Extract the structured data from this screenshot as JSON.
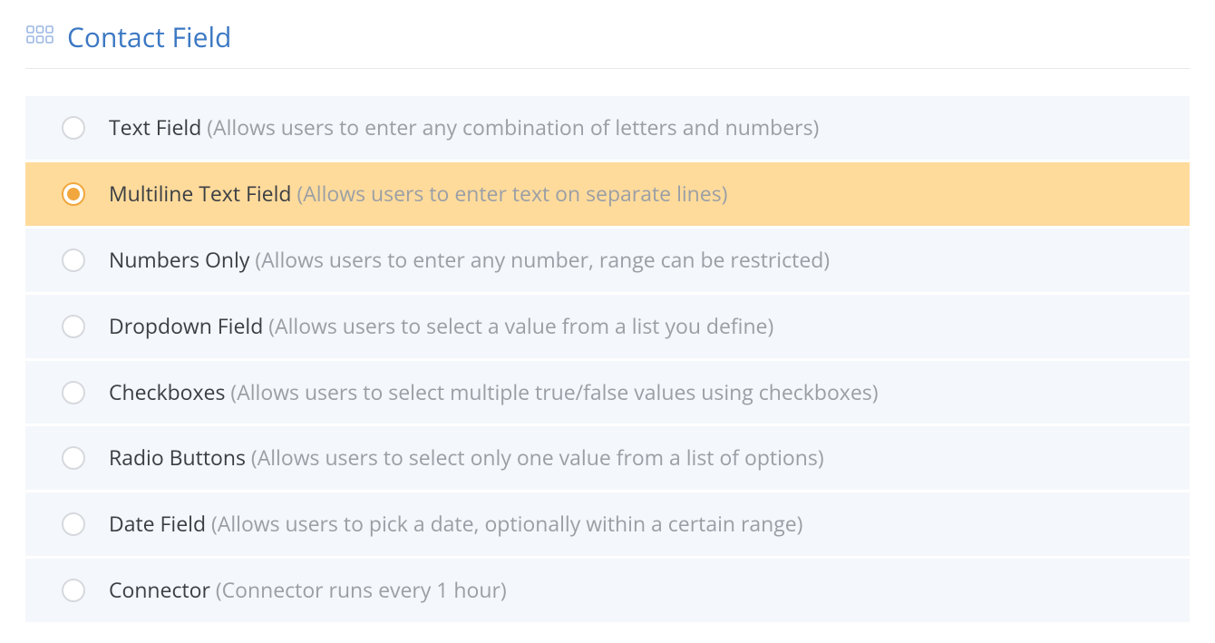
{
  "header": {
    "title": "Contact Field"
  },
  "options": [
    {
      "name": "Text Field",
      "desc": "(Allows users to enter any combination of letters and numbers)",
      "selected": false
    },
    {
      "name": "Multiline Text Field",
      "desc": "(Allows users to enter text on separate lines)",
      "selected": true
    },
    {
      "name": "Numbers Only",
      "desc": "(Allows users to enter any number, range can be restricted)",
      "selected": false
    },
    {
      "name": "Dropdown Field",
      "desc": "(Allows users to select a value from a list you define)",
      "selected": false
    },
    {
      "name": "Checkboxes",
      "desc": "(Allows users to select multiple true/false values using checkboxes)",
      "selected": false
    },
    {
      "name": "Radio Buttons",
      "desc": "(Allows users to select only one value from a list of options)",
      "selected": false
    },
    {
      "name": "Date Field",
      "desc": "(Allows users to pick a date, optionally within a certain range)",
      "selected": false
    },
    {
      "name": "Connector",
      "desc": "(Connector runs every 1 hour)",
      "selected": false
    }
  ]
}
